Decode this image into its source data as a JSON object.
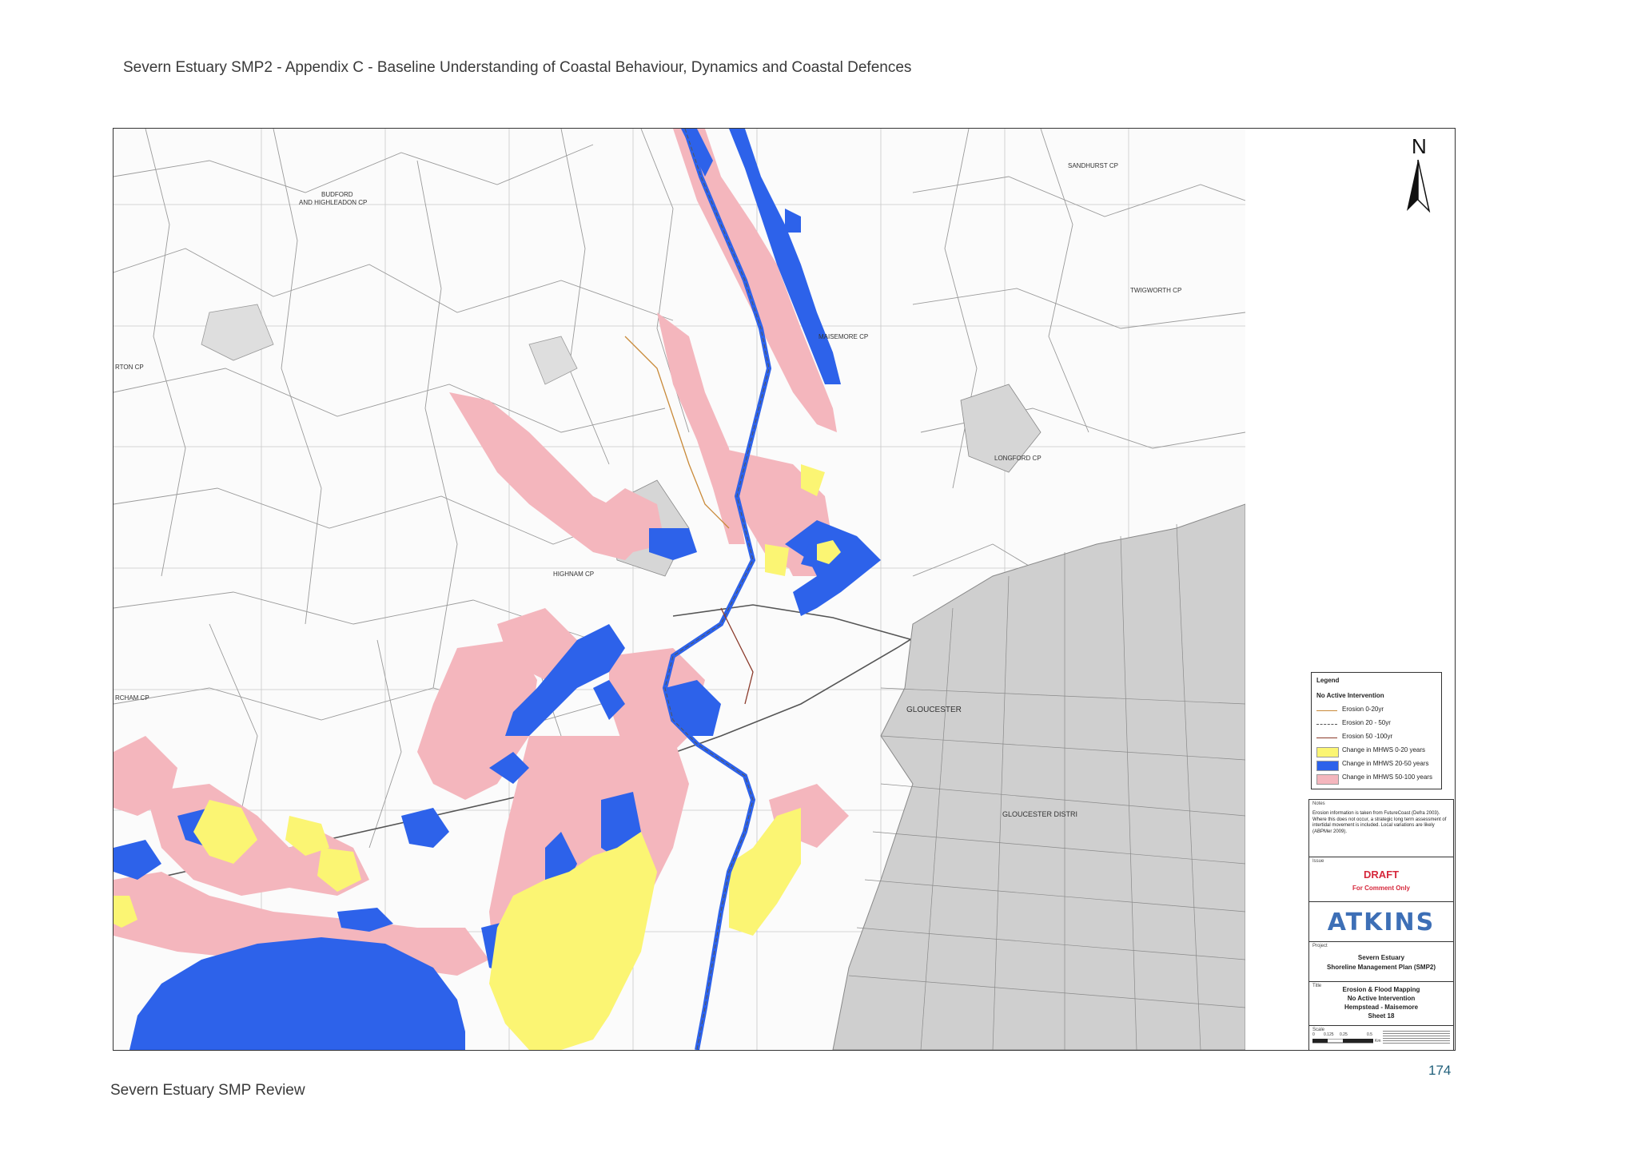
{
  "header": {
    "running_title": "Severn Estuary SMP2 - Appendix C - Baseline Understanding of Coastal Behaviour, Dynamics and Coastal Defences"
  },
  "footer": {
    "running_title": "Severn Estuary SMP Review",
    "page_number": "174"
  },
  "map": {
    "north_label": "N",
    "place_names": {
      "budford": "BUDFORD",
      "highleadon": "AND HIGHLEADON CP",
      "sandhurst": "SANDHURST CP",
      "twigworth": "TWIGWORTH CP",
      "maisemore": "MAISEMORE CP",
      "rton": "RTON CP",
      "longford": "LONGFORD CP",
      "highnam": "HIGHNAM CP",
      "rcham": "RCHAM CP",
      "gloucester": "GLOUCESTER",
      "gloucester_district": "GLOUCESTER DISTRI"
    },
    "colors": {
      "mhws_0_20": "#fbf573",
      "mhws_20_50": "#2d62ea",
      "mhws_50_100": "#f4b6bd",
      "erosion_0_20": "#c98a3a",
      "erosion_20_50": "#555555",
      "erosion_50_100": "#8b3a2a"
    }
  },
  "legend": {
    "title": "Legend",
    "subtitle": "No Active Intervention",
    "items": [
      {
        "label": "Erosion 0-20yr",
        "kind": "line-solid",
        "color": "#c98a3a"
      },
      {
        "label": "Erosion 20 - 50yr",
        "kind": "line-dashed",
        "color": "#555555"
      },
      {
        "label": "Erosion 50 -100yr",
        "kind": "line-solid",
        "color": "#8b3a2a"
      },
      {
        "label": "Change in MHWS 0-20 years",
        "kind": "fill",
        "color": "#fbf573"
      },
      {
        "label": "Change in MHWS 20-50 years",
        "kind": "fill",
        "color": "#2d62ea"
      },
      {
        "label": "Change in MHWS 50-100 years",
        "kind": "fill",
        "color": "#f4b6bd"
      }
    ]
  },
  "title_block": {
    "notes_label": "Notes",
    "notes_text": "Erosion information is taken from FutureCoast (Defra 2003). Where this does not occur, a strategic long term assessment of intertidal movement is included. Local variations are likely (ABPMer 2009).",
    "status_label": "Issue",
    "draft": "DRAFT",
    "draft_sub": "For Comment Only",
    "company": "ATKINS",
    "project_label": "Project",
    "project_line1": "Severn Estuary",
    "project_line2": "Shoreline Management Plan (SMP2)",
    "title_label": "Title",
    "title_line1": "Erosion & Flood Mapping",
    "title_line2": "No Active Intervention",
    "title_line3": "Hempstead - Maisemore",
    "title_line4": "Sheet 18",
    "scale_label": "Scale",
    "scale_ticks": [
      "0",
      "0.125",
      "0.25",
      "0.5"
    ],
    "scale_unit": "Km"
  }
}
